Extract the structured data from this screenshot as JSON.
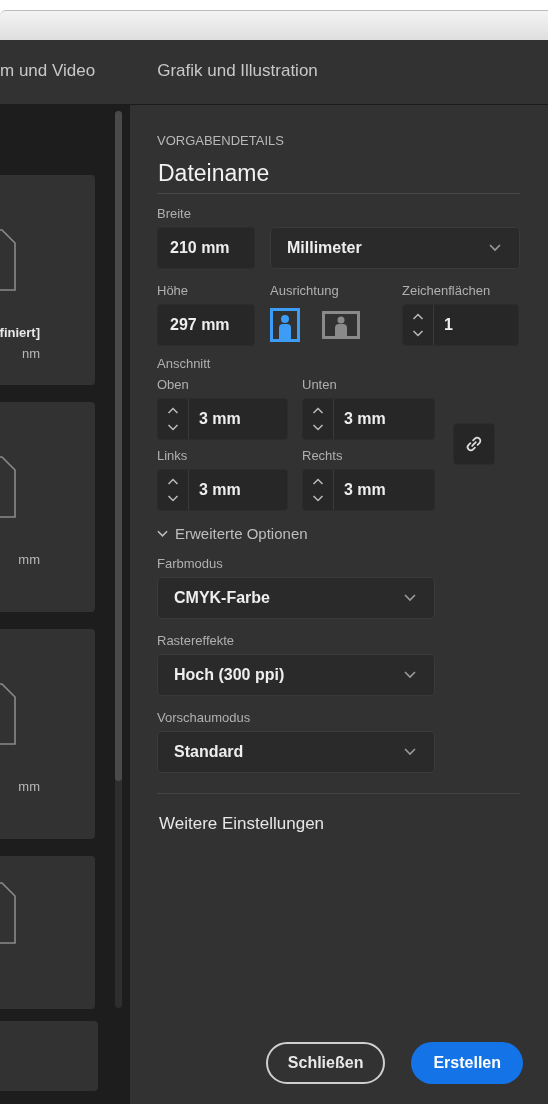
{
  "tabs": [
    {
      "label": "m und Video",
      "selected": false
    },
    {
      "label": "Grafik und Illustration",
      "selected": false
    }
  ],
  "presets": [
    {
      "name": "finiert]",
      "size": "nm",
      "selected": false
    },
    {
      "size": "mm",
      "selected": false
    },
    {
      "size": "mm",
      "selected": false
    },
    {
      "selected": false
    }
  ],
  "details": {
    "heading": "VORGABENDETAILS",
    "filename": "Dateiname",
    "width": {
      "label": "Breite",
      "value": "210 mm"
    },
    "unit": {
      "value": "Millimeter"
    },
    "height": {
      "label": "Höhe",
      "value": "297 mm"
    },
    "orientation": {
      "label": "Ausrichtung",
      "options": [
        {
          "kind": "portrait",
          "selected": true
        },
        {
          "kind": "landscape",
          "selected": false
        }
      ]
    },
    "artboards": {
      "label": "Zeichenflächen",
      "value": "1"
    },
    "bleed": {
      "label": "Anschnitt",
      "fields": [
        {
          "label": "Oben",
          "value": "3 mm"
        },
        {
          "label": "Unten",
          "value": "3 mm"
        },
        {
          "label": "Links",
          "value": "3 mm"
        },
        {
          "label": "Rechts",
          "value": "3 mm"
        }
      ],
      "linked": false
    },
    "advanced": {
      "label": "Erweiterte Optionen",
      "expanded": true,
      "dropdowns": [
        {
          "label": "Farbmodus",
          "value": "CMYK-Farbe"
        },
        {
          "label": "Rastereffekte",
          "value": "Hoch (300 ppi)"
        },
        {
          "label": "Vorschaumodus",
          "value": "Standard"
        }
      ]
    },
    "more_settings": "Weitere Einstellungen"
  },
  "buttons": [
    {
      "label": "Schließen",
      "kind": "secondary"
    },
    {
      "label": "Erstellen",
      "kind": "primary"
    }
  ]
}
